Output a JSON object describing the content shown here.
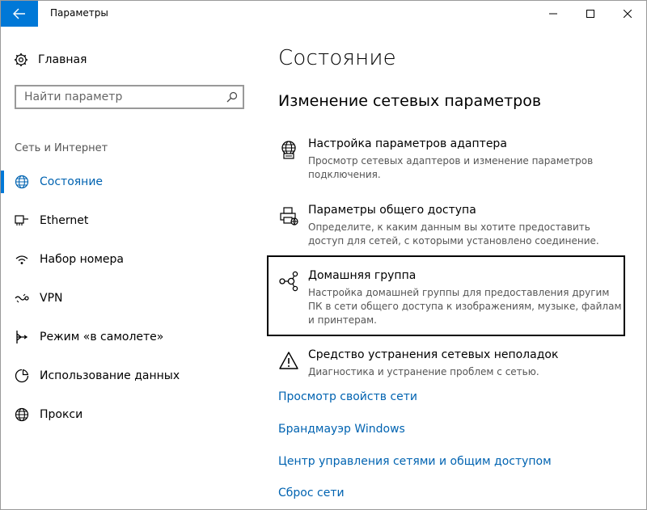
{
  "window": {
    "title": "Параметры"
  },
  "sidebar": {
    "home_label": "Главная",
    "search": {
      "placeholder": "Найти параметр"
    },
    "section_label": "Сеть и Интернет",
    "items": [
      {
        "label": "Состояние",
        "icon": "globe-icon",
        "selected": true
      },
      {
        "label": "Ethernet",
        "icon": "ethernet-icon",
        "selected": false
      },
      {
        "label": "Набор номера",
        "icon": "dialup-icon",
        "selected": false
      },
      {
        "label": "VPN",
        "icon": "vpn-icon",
        "selected": false
      },
      {
        "label": "Режим «в самолете»",
        "icon": "airplane-icon",
        "selected": false
      },
      {
        "label": "Использование данных",
        "icon": "data-usage-icon",
        "selected": false
      },
      {
        "label": "Прокси",
        "icon": "globe-icon",
        "selected": false
      }
    ]
  },
  "main": {
    "page_title": "Состояние",
    "section_title": "Изменение сетевых параметров",
    "entries": [
      {
        "title": "Настройка параметров адаптера",
        "desc": "Просмотр сетевых адаптеров и изменение параметров подключения.",
        "icon": "adapter-globe-icon"
      },
      {
        "title": "Параметры общего доступа",
        "desc": "Определите, к каким данным вы хотите предоставить доступ для сетей, с которыми установлено соединение.",
        "icon": "sharing-printer-icon"
      },
      {
        "title": "Домашняя группа",
        "desc": "Настройка домашней группы для предоставления другим ПК в сети общего доступа к изображениям, музыке, файлам и принтерам.",
        "icon": "homegroup-icon"
      },
      {
        "title": "Средство устранения сетевых неполадок",
        "desc": "Диагностика и устранение проблем с сетью.",
        "icon": "warning-icon"
      }
    ],
    "links": [
      "Просмотр свойств сети",
      "Брандмауэр Windows",
      "Центр управления сетями и общим доступом",
      "Сброс сети"
    ]
  },
  "colors": {
    "accent": "#0078d7",
    "link": "#0063b1",
    "secondary_text": "#555555"
  }
}
